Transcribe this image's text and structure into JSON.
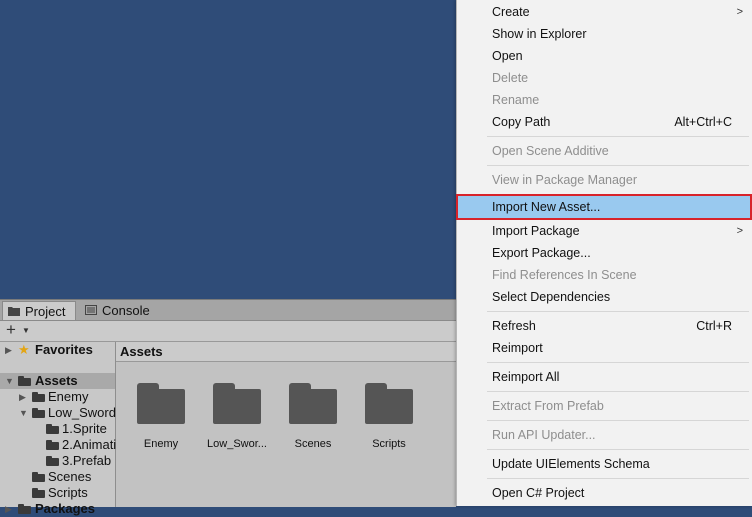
{
  "project_panel": {
    "tabs": [
      {
        "label": "Project",
        "icon": "folder-icon"
      },
      {
        "label": "Console",
        "icon": "console-icon"
      }
    ],
    "add_button": "+",
    "tree": {
      "favorites": "Favorites",
      "assets": "Assets",
      "enemy": "Enemy",
      "low_sword": "Low_Sword",
      "sprite": "1.Sprite",
      "animation": "2.Animati",
      "prefab": "3.Prefab",
      "scenes": "Scenes",
      "scripts": "Scripts",
      "packages": "Packages"
    },
    "breadcrumb": "Assets",
    "assets": [
      {
        "label": "Enemy"
      },
      {
        "label": "Low_Swor..."
      },
      {
        "label": "Scenes"
      },
      {
        "label": "Scripts"
      }
    ]
  },
  "context_menu": {
    "create": "Create",
    "show_in_explorer": "Show in Explorer",
    "open": "Open",
    "delete": "Delete",
    "rename": "Rename",
    "copy_path": "Copy Path",
    "copy_path_shortcut": "Alt+Ctrl+C",
    "open_scene_additive": "Open Scene Additive",
    "view_in_package_manager": "View in Package Manager",
    "import_new_asset": "Import New Asset...",
    "import_package": "Import Package",
    "export_package": "Export Package...",
    "find_references": "Find References In Scene",
    "select_dependencies": "Select Dependencies",
    "refresh": "Refresh",
    "refresh_shortcut": "Ctrl+R",
    "reimport": "Reimport",
    "reimport_all": "Reimport All",
    "extract_from_prefab": "Extract From Prefab",
    "run_api_updater": "Run API Updater...",
    "update_uielements": "Update UIElements Schema",
    "open_csharp_project": "Open C# Project",
    "submenu_arrow": ">"
  },
  "colors": {
    "scene_bg": "#2f4c78",
    "menu_highlight": "#99c9ef",
    "highlight_outline": "#d8232a"
  }
}
